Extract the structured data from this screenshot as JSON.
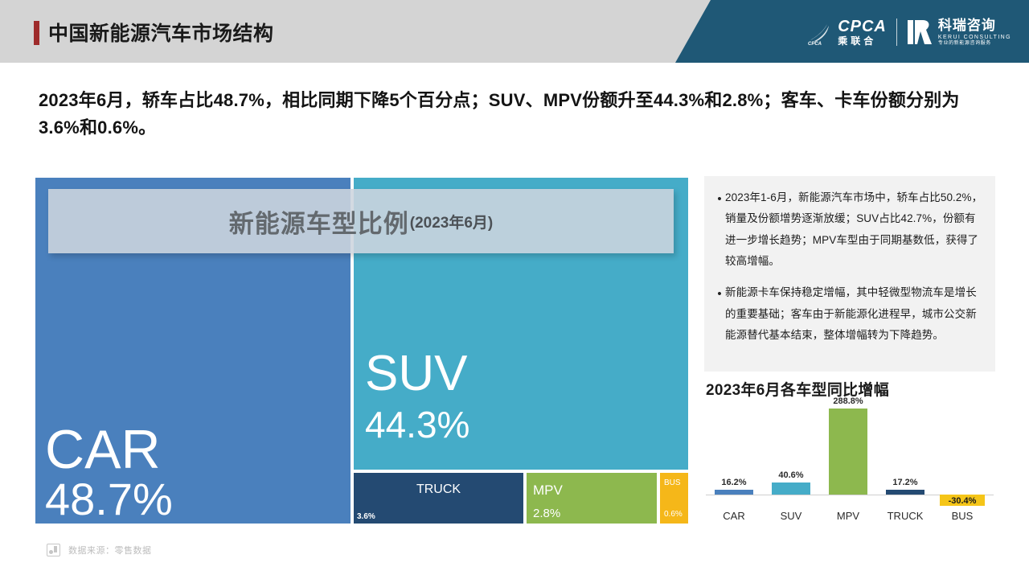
{
  "header": {
    "title": "中国新能源汽车市场结构",
    "accent_color": "#9e2b2b",
    "banner_color": "#1f5876",
    "logos": {
      "cpca_main": "CPCA",
      "cpca_sub": "乘联合",
      "kerui_cn": "科瑞咨询",
      "kerui_en": "KERUI CONSULTING",
      "kerui_tag": "专业的新能源咨询服务"
    }
  },
  "subtitle": "2023年6月，轿车占比48.7%，相比同期下降5个百分点；SUV、MPV份额升至44.3%和2.8%；客车、卡车份额分别为3.6%和0.6%。",
  "treemap": {
    "title_main": "新能源车型比例",
    "title_sub": "(2023年6月)",
    "blocks": [
      {
        "name": "CAR",
        "value": "48.7%",
        "color": "#4a80bd"
      },
      {
        "name": "SUV",
        "value": "44.3%",
        "color": "#45acc8"
      },
      {
        "name": "TRUCK",
        "value": "3.6%",
        "color": "#244a72"
      },
      {
        "name": "MPV",
        "value": "2.8%",
        "color": "#8db84e"
      },
      {
        "name": "BUS",
        "value": "0.6%",
        "color": "#f5b719"
      }
    ]
  },
  "notes": {
    "bullet_glyph": "•",
    "items": [
      "2023年1-6月，新能源汽车市场中，轿车占比50.2%，销量及份额增势逐渐放缓；SUV占比42.7%，份额有进一步增长趋势；MPV车型由于同期基数低，获得了较高增幅。",
      "新能源卡车保持稳定增幅，其中轻微型物流车是增长的重要基础；客车由于新能源化进程早，城市公交新能源替代基本结束，整体增幅转为下降趋势。"
    ]
  },
  "footer": {
    "source_text": "数据来源：零售数据",
    "icon": "chart-icon"
  },
  "chart_data": {
    "type": "bar",
    "title": "2023年6月各车型同比增幅",
    "xlabel": "",
    "ylabel": "",
    "categories": [
      "CAR",
      "SUV",
      "MPV",
      "TRUCK",
      "BUS"
    ],
    "values": [
      16.2,
      40.6,
      288.8,
      17.2,
      -30.4
    ],
    "data_labels": [
      "16.2%",
      "40.6%",
      "288.8%",
      "17.2%",
      "-30.4%"
    ],
    "colors": [
      "#4a80bd",
      "#45acc8",
      "#8db84e",
      "#244a72",
      "#f5c518"
    ],
    "ylim": [
      -30.4,
      288.8
    ],
    "grid": false,
    "legend": "none",
    "unit": "%"
  }
}
